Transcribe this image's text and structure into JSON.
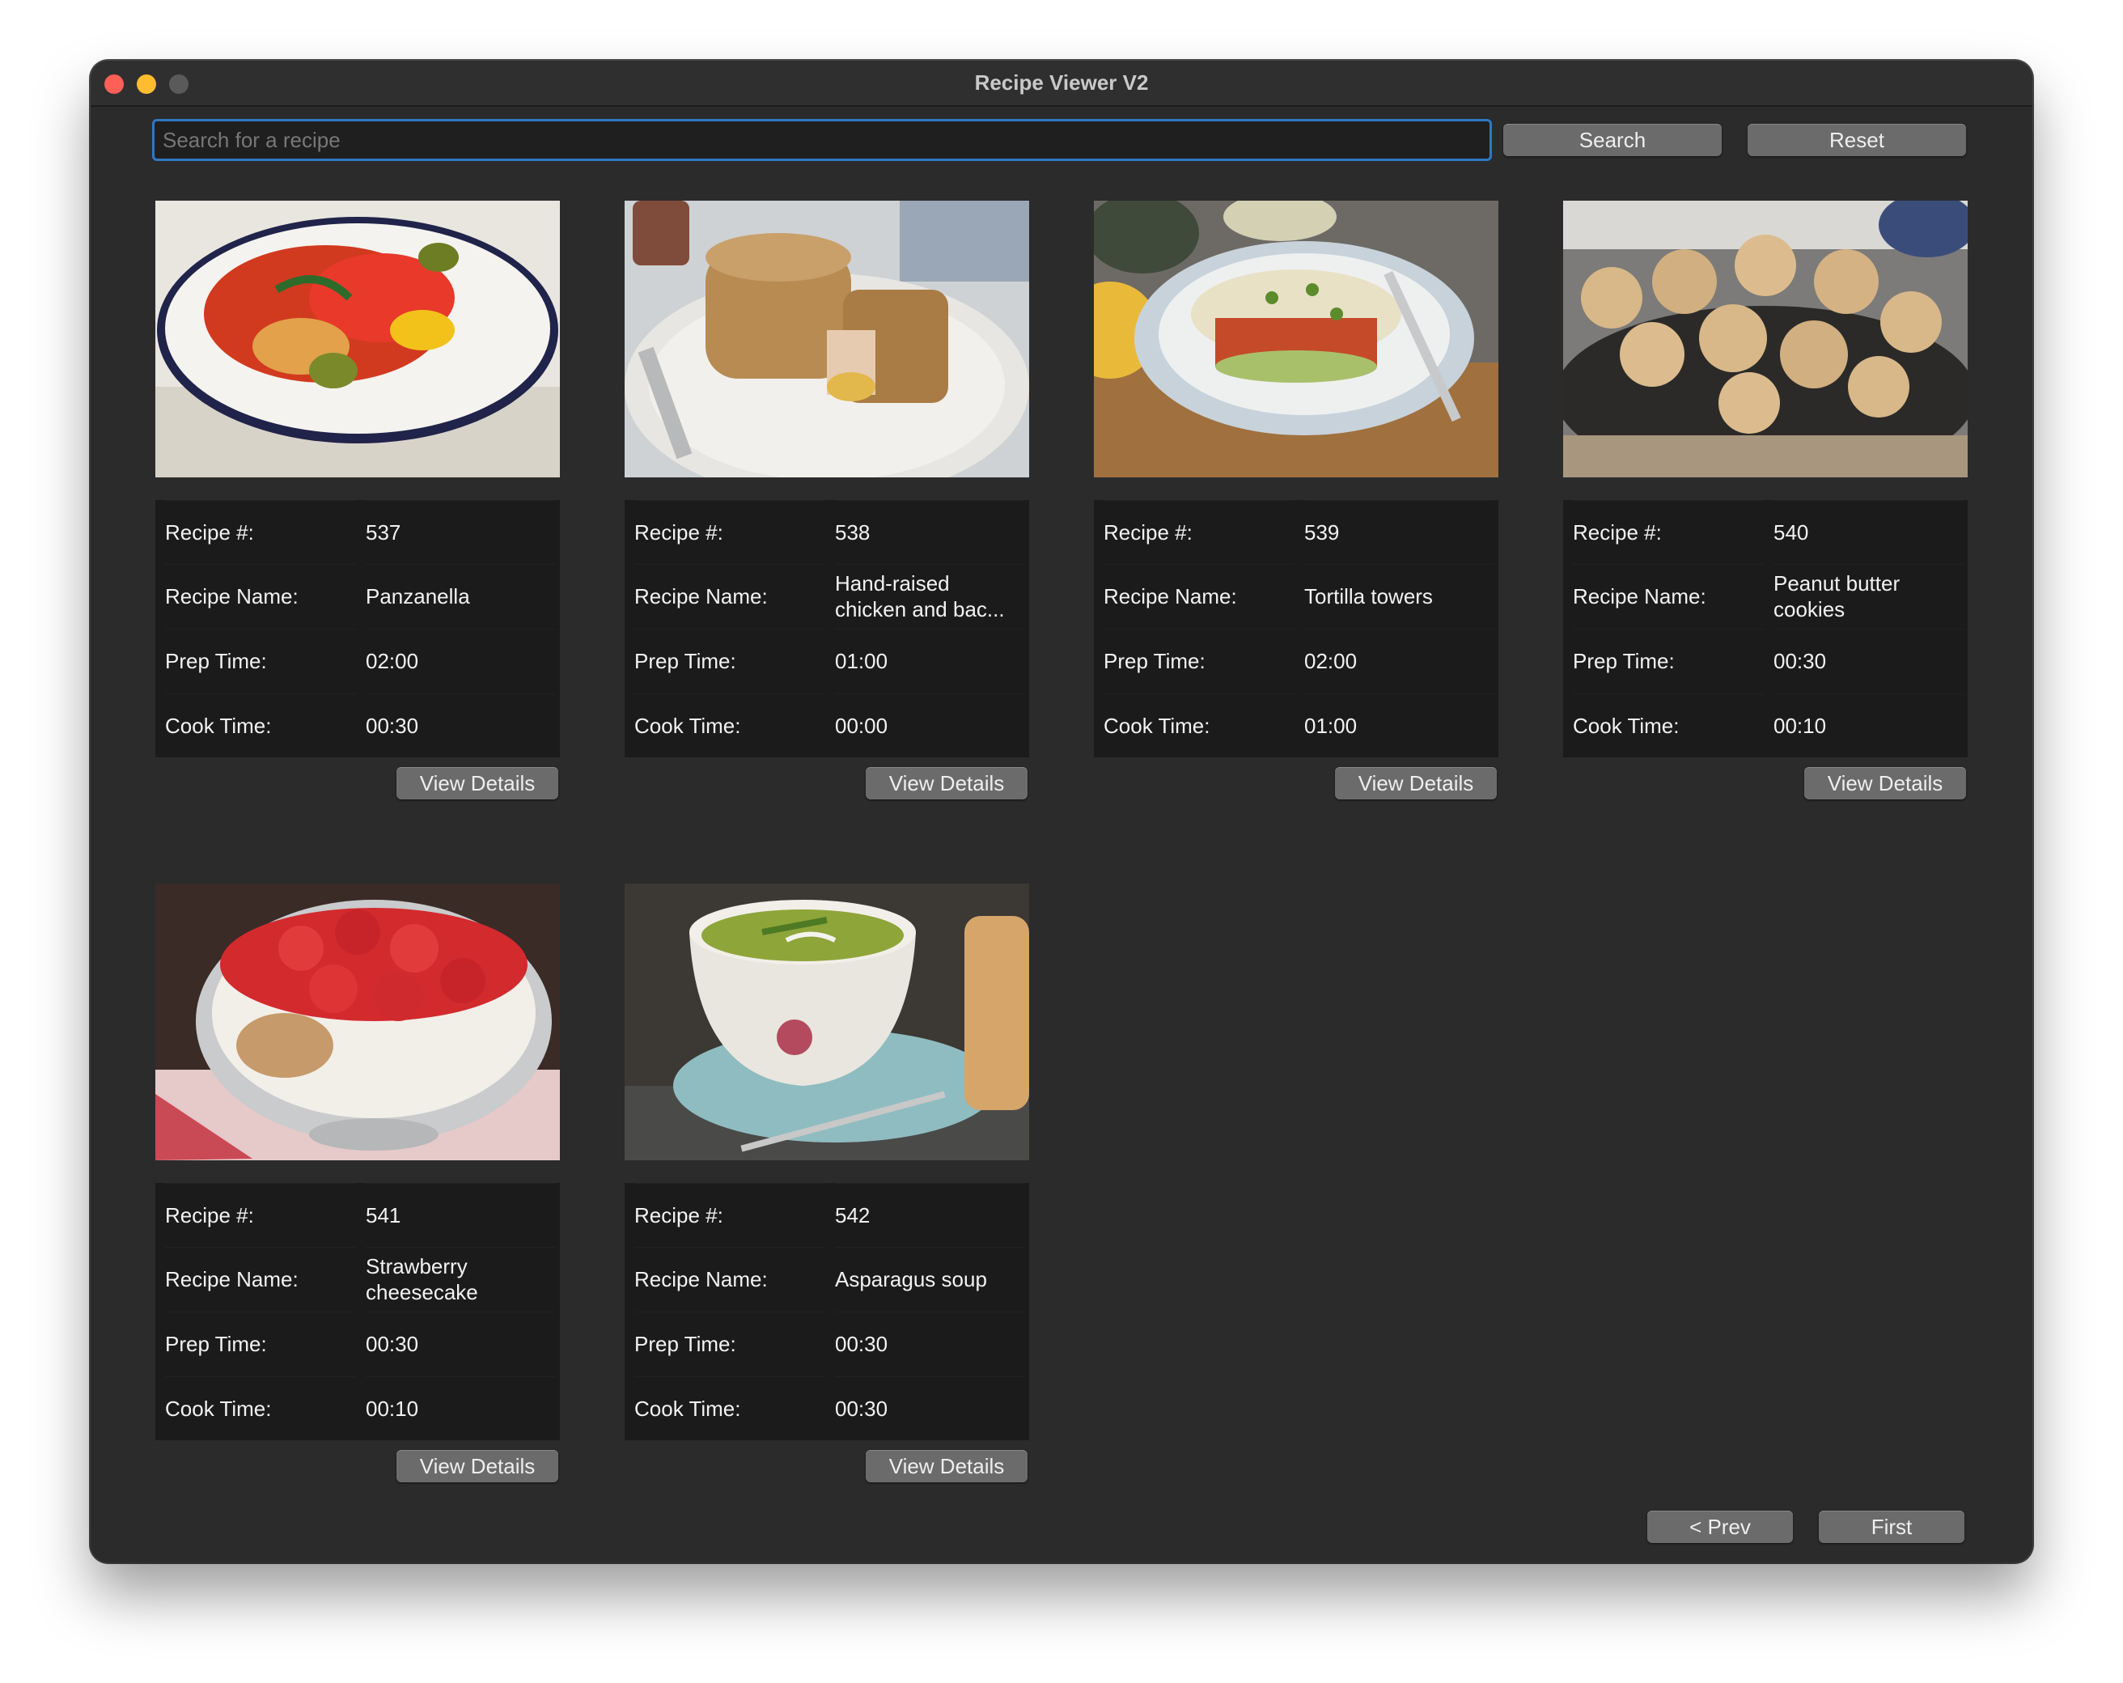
{
  "window": {
    "title": "Recipe Viewer V2"
  },
  "search": {
    "placeholder": "Search for a recipe",
    "button_label": "Search",
    "reset_label": "Reset"
  },
  "labels": {
    "number": "Recipe #:",
    "name": "Recipe Name:",
    "prep": "Prep Time:",
    "cook": "Cook Time:",
    "view_details": "View Details"
  },
  "recipes": [
    {
      "number": "537",
      "name": "Panzanella",
      "prep": "02:00",
      "cook": "00:30",
      "image": "plate-of-roasted-peppers-salad"
    },
    {
      "number": "538",
      "name": "Hand-raised chicken and bac...",
      "prep": "01:00",
      "cook": "00:00",
      "image": "raised-pie-on-plate"
    },
    {
      "number": "539",
      "name": "Tortilla towers",
      "prep": "02:00",
      "cook": "01:00",
      "image": "stacked-tortillas-on-plate"
    },
    {
      "number": "540",
      "name": "Peanut butter cookies",
      "prep": "00:30",
      "cook": "00:10",
      "image": "cookies-on-cooling-rack"
    },
    {
      "number": "541",
      "name": "Strawberry cheesecake",
      "prep": "00:30",
      "cook": "00:10",
      "image": "strawberry-cheesecake-in-glass-bowl"
    },
    {
      "number": "542",
      "name": "Asparagus soup",
      "prep": "00:30",
      "cook": "00:30",
      "image": "green-soup-in-bowl"
    }
  ],
  "pagination": {
    "prev_label": "< Prev",
    "first_label": "First"
  }
}
